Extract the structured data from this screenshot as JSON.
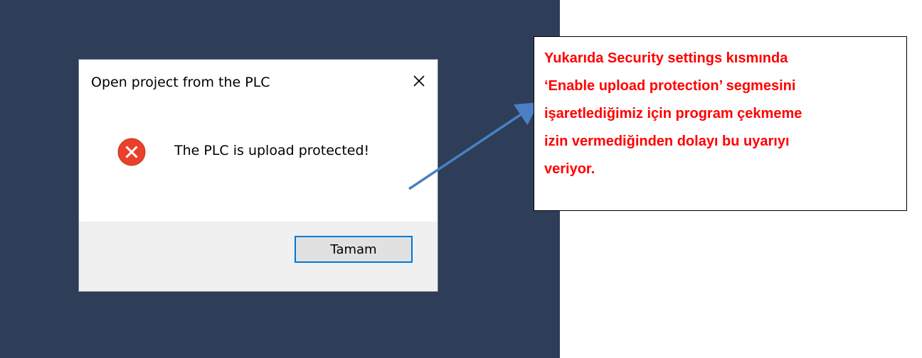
{
  "dialog": {
    "title": "Open project from the PLC",
    "close_icon": "close-icon",
    "error_icon": "error-circle-x-icon",
    "message": "The PLC is upload protected!",
    "ok_label": "Tamam"
  },
  "callout": {
    "text": "Yukarıda Security settings kısmında\n‘Enable upload protection’ segmesini\nişaretlediğimiz için program çekmeme\nizin vermediğinden dolayı bu uyarıyı\nveriyor."
  },
  "colors": {
    "desktop_bg": "#2e3e58",
    "error_red": "#e8412c",
    "button_accent": "#0078d7",
    "callout_text": "#ff0000",
    "arrow": "#4a7fc4"
  }
}
